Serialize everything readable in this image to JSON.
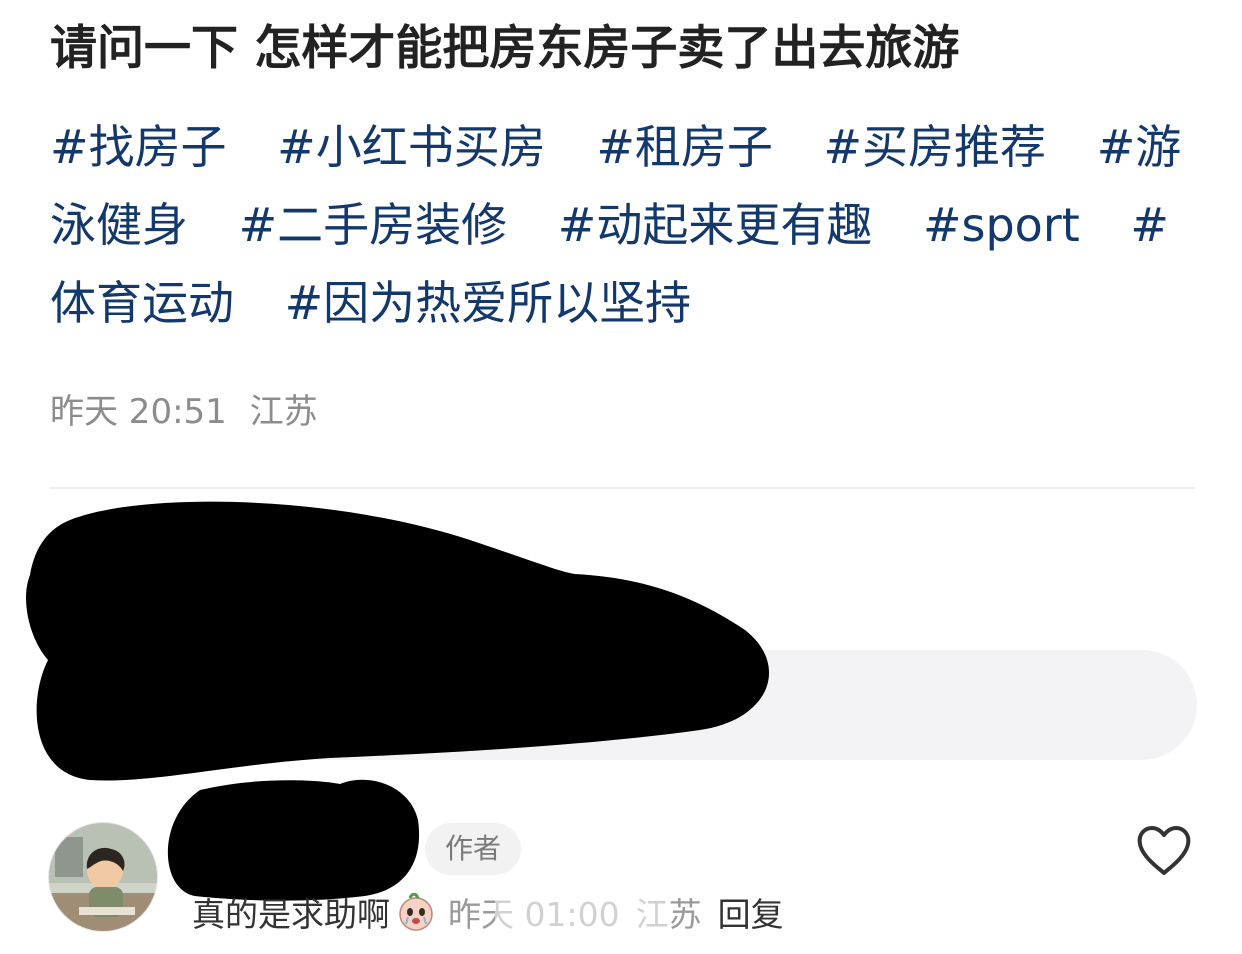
{
  "post": {
    "title": "请问一下 怎样才能把房东房子卖了出去旅游",
    "tags": [
      "#找房子",
      "#小红书买房",
      "#租房子",
      "#买房推荐",
      "#游泳健身",
      "#二手房装修",
      "#动起来更有趣",
      "#sport",
      "#体育运动",
      "#因为热爱所以坚持"
    ],
    "time": "昨天 20:51",
    "location": "江苏"
  },
  "comment": {
    "author_badge": "作者",
    "text": "真的是求助啊",
    "sticker_icon": "crying-face-sticker-icon",
    "time": "昨天 01:00",
    "location": "江苏",
    "reply_label": "回复",
    "like_icon": "heart-outline-icon"
  },
  "colors": {
    "tag": "#13386c",
    "meta": "#8c8c8c",
    "bubble": "#f3f3f5",
    "redaction": "#000000"
  }
}
